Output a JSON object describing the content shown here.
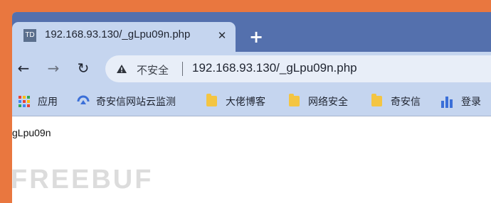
{
  "browser": {
    "tab": {
      "favicon_text": "TD",
      "title": "192.168.93.130/_gLpu09n.php",
      "close_symbol": "✕"
    },
    "new_tab_symbol": "+",
    "nav": {
      "back_symbol": "←",
      "forward_symbol": "→",
      "reload_symbol": "↻"
    },
    "address_bar": {
      "security_label": "不安全",
      "url": "192.168.93.130/_gLpu09n.php"
    },
    "bookmarks": [
      {
        "label": "应用",
        "icon": "apps-grid-icon"
      },
      {
        "label": "奇安信网站云监测",
        "icon": "qianxin-logo-icon"
      },
      {
        "label": "大佬博客",
        "icon": "folder-icon"
      },
      {
        "label": "网络安全",
        "icon": "folder-icon"
      },
      {
        "label": "奇安信",
        "icon": "folder-icon"
      },
      {
        "label": "登录",
        "icon": "bar-chart-icon"
      }
    ]
  },
  "page": {
    "body_text": "gLpu09n"
  },
  "watermark": "FREEBUF",
  "colors": {
    "desktop": "#e9773f",
    "titlebar": "#5470ad",
    "toolbar": "#c5d5ef"
  }
}
